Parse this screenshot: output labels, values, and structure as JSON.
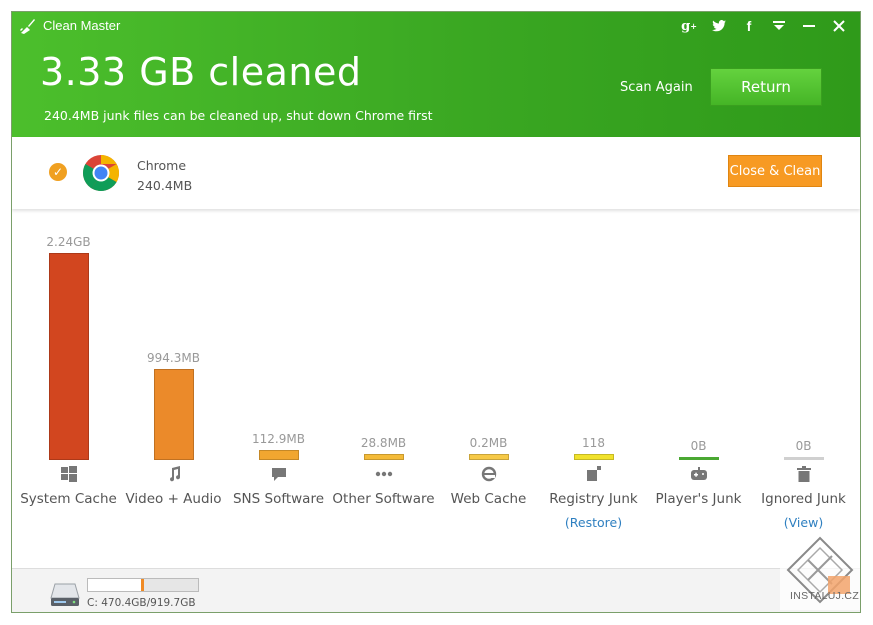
{
  "app": {
    "title": "Clean Master"
  },
  "window_controls": [
    "google-plus",
    "twitter",
    "facebook",
    "menu",
    "minimize",
    "close"
  ],
  "header": {
    "headline": "3.33 GB cleaned",
    "subline": "240.4MB junk files can be cleaned up, shut down Chrome first",
    "scan_again": "Scan Again",
    "return_label": "Return"
  },
  "chrome_item": {
    "name": "Chrome",
    "size": "240.4MB",
    "button": "Close & Clean"
  },
  "categories": [
    {
      "label": "System Cache",
      "value": "2.24GB",
      "fraction": 1.0,
      "color": "#d2461f",
      "icon": "windows-icon"
    },
    {
      "label": "Video + Audio",
      "value": "994.3MB",
      "fraction": 0.44,
      "color": "#eb8a2a",
      "icon": "music-note-icon"
    },
    {
      "label": "SNS Software",
      "value": "112.9MB",
      "fraction": 0.05,
      "color": "#f1a630",
      "icon": "chat-bubble-icon"
    },
    {
      "label": "Other Software",
      "value": "28.8MB",
      "fraction": 0.028,
      "color": "#f4bb39",
      "icon": "dots-icon"
    },
    {
      "label": "Web Cache",
      "value": "0.2MB",
      "fraction": 0.028,
      "color": "#f6c947",
      "icon": "ie-icon"
    },
    {
      "label": "Registry Junk",
      "value": "118",
      "fraction": 0.028,
      "color": "#f1e22c",
      "icon": "registry-icon",
      "link": "(Restore)"
    },
    {
      "label": "Player's Junk",
      "value": "0B",
      "fraction": 0.0,
      "color": "#4aa832",
      "icon": "gamepad-icon"
    },
    {
      "label": "Ignored Junk",
      "value": "0B",
      "fraction": 0.0,
      "color": "#d0d0d0",
      "icon": "trash-icon",
      "link": "(View)"
    }
  ],
  "disk": {
    "label": "C: 470.4GB/919.7GB",
    "used_fraction": 0.51
  },
  "watermark": "INSTALUJ.CZ"
}
